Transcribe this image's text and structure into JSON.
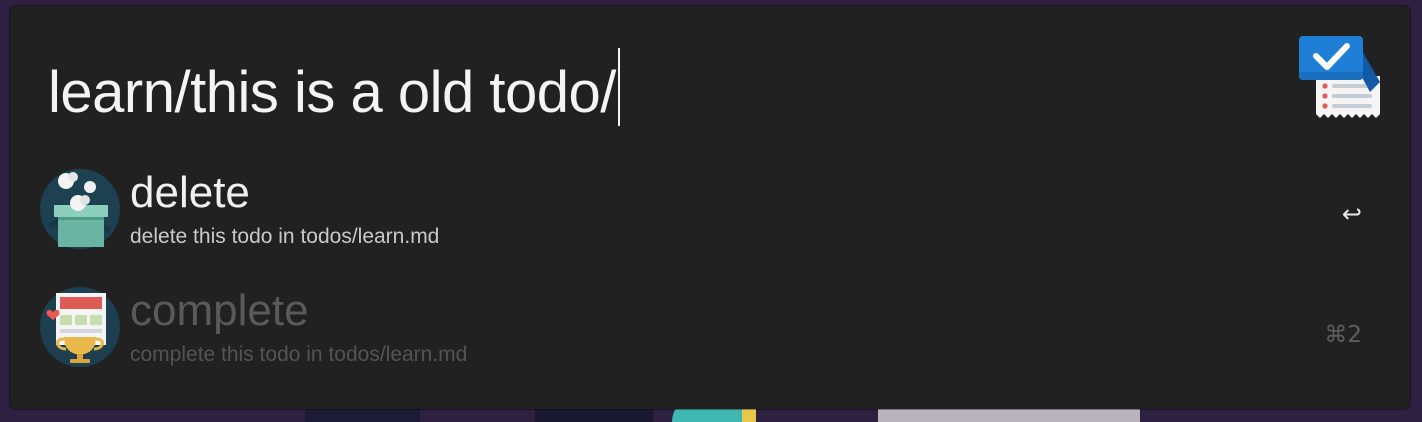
{
  "search": {
    "query": "learn/this is a old todo/"
  },
  "app_icon": "todo-checklist-icon",
  "results": [
    {
      "icon": "trash-bin-icon",
      "title": "delete",
      "subtitle": "delete this todo in todos/learn.md",
      "shortcut": "↩"
    },
    {
      "icon": "trophy-document-icon",
      "title": "complete",
      "subtitle": "complete this todo in todos/learn.md",
      "shortcut": "⌘2"
    }
  ],
  "colors": {
    "panel_background": "#212121",
    "primary_text": "#f4f4f4",
    "dimmed_text": "#5a5a5a",
    "accent_blue": "#1f7fd6"
  }
}
